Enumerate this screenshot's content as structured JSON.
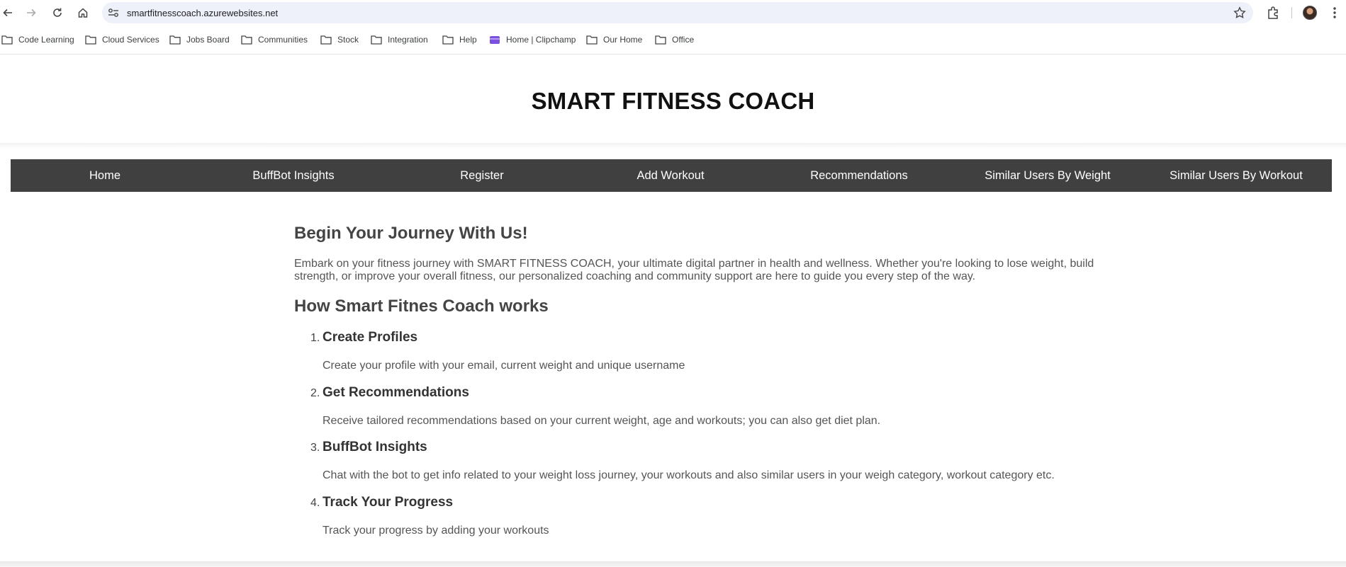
{
  "browser": {
    "url": "smartfitnesscoach.azurewebsites.net",
    "bookmarks": [
      {
        "label": "Code Learning",
        "icon": "folder-icon"
      },
      {
        "label": "Cloud Services",
        "icon": "folder-icon"
      },
      {
        "label": "Jobs Board",
        "icon": "folder-icon"
      },
      {
        "label": "Communities",
        "icon": "folder-icon"
      },
      {
        "label": "Stock",
        "icon": "folder-icon"
      },
      {
        "label": "Integration",
        "icon": "folder-icon"
      },
      {
        "label": "Help",
        "icon": "folder-icon"
      },
      {
        "label": "Home | Clipchamp",
        "icon": "clipchamp-icon"
      },
      {
        "label": "Our Home",
        "icon": "folder-icon"
      },
      {
        "label": "Office",
        "icon": "folder-icon"
      }
    ]
  },
  "site": {
    "title": "SMART FITNESS COACH",
    "nav": [
      "Home",
      "BuffBot Insights",
      "Register",
      "Add Workout",
      "Recommendations",
      "Similar Users By Weight",
      "Similar Users By Workout"
    ]
  },
  "main": {
    "journey_heading": "Begin Your Journey With Us!",
    "journey_text": "Embark on your fitness journey with SMART FITNESS COACH, your ultimate digital partner in health and wellness. Whether you're looking to lose weight, build strength, or improve your overall fitness, our personalized coaching and community support are here to guide you every step of the way.",
    "how_heading": "How Smart Fitnes Coach works",
    "steps": [
      {
        "num": "1.",
        "title": "Create Profiles",
        "text": "Create your profile with your email, current weight and unique username"
      },
      {
        "num": "2.",
        "title": "Get Recommendations",
        "text": "Receive tailored recommendations based on your current weight, age and workouts; you can also get diet plan."
      },
      {
        "num": "3.",
        "title": "BuffBot Insights",
        "text": "Chat with the bot to get info related to your weight loss journey, your workouts and also similar users in your weigh category, workout category etc."
      },
      {
        "num": "4.",
        "title": "Track Your Progress",
        "text": "Track your progress by adding your workouts"
      }
    ]
  }
}
